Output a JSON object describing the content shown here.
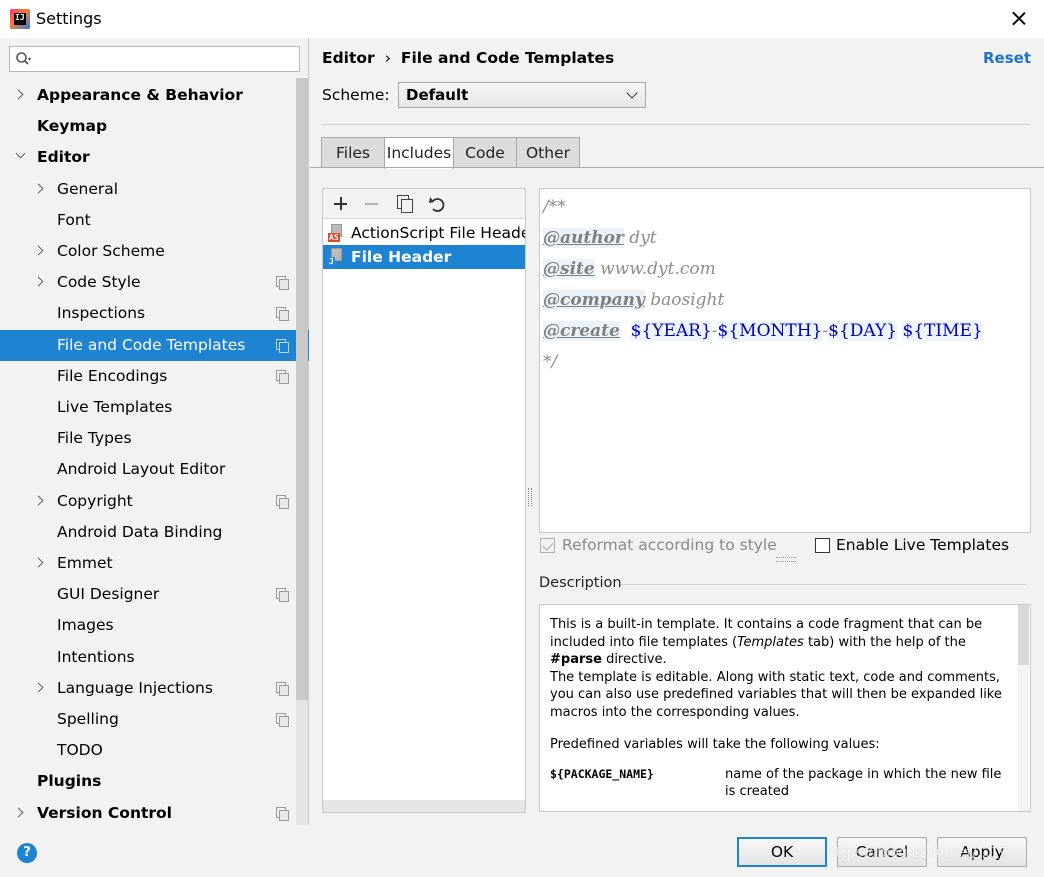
{
  "window": {
    "title": "Settings",
    "icon_text": "IJ"
  },
  "search": {
    "placeholder": ""
  },
  "tree": [
    {
      "label": "Appearance & Behavior",
      "bold": true,
      "arrow": "right",
      "level": 0,
      "copy": false
    },
    {
      "label": "Keymap",
      "bold": true,
      "arrow": "none",
      "level": 0,
      "copy": false
    },
    {
      "label": "Editor",
      "bold": true,
      "arrow": "down",
      "level": 0,
      "copy": false
    },
    {
      "label": "General",
      "bold": false,
      "arrow": "right",
      "level": 1,
      "copy": false
    },
    {
      "label": "Font",
      "bold": false,
      "arrow": "none",
      "level": 1,
      "copy": false
    },
    {
      "label": "Color Scheme",
      "bold": false,
      "arrow": "right",
      "level": 1,
      "copy": false
    },
    {
      "label": "Code Style",
      "bold": false,
      "arrow": "right",
      "level": 1,
      "copy": true
    },
    {
      "label": "Inspections",
      "bold": false,
      "arrow": "none",
      "level": 1,
      "copy": true
    },
    {
      "label": "File and Code Templates",
      "bold": false,
      "arrow": "none",
      "level": 1,
      "copy": true,
      "selected": true
    },
    {
      "label": "File Encodings",
      "bold": false,
      "arrow": "none",
      "level": 1,
      "copy": true
    },
    {
      "label": "Live Templates",
      "bold": false,
      "arrow": "none",
      "level": 1,
      "copy": false
    },
    {
      "label": "File Types",
      "bold": false,
      "arrow": "none",
      "level": 1,
      "copy": false
    },
    {
      "label": "Android Layout Editor",
      "bold": false,
      "arrow": "none",
      "level": 1,
      "copy": false
    },
    {
      "label": "Copyright",
      "bold": false,
      "arrow": "right",
      "level": 1,
      "copy": true
    },
    {
      "label": "Android Data Binding",
      "bold": false,
      "arrow": "none",
      "level": 1,
      "copy": false
    },
    {
      "label": "Emmet",
      "bold": false,
      "arrow": "right",
      "level": 1,
      "copy": false
    },
    {
      "label": "GUI Designer",
      "bold": false,
      "arrow": "none",
      "level": 1,
      "copy": true
    },
    {
      "label": "Images",
      "bold": false,
      "arrow": "none",
      "level": 1,
      "copy": false
    },
    {
      "label": "Intentions",
      "bold": false,
      "arrow": "none",
      "level": 1,
      "copy": false
    },
    {
      "label": "Language Injections",
      "bold": false,
      "arrow": "right",
      "level": 1,
      "copy": true
    },
    {
      "label": "Spelling",
      "bold": false,
      "arrow": "none",
      "level": 1,
      "copy": true
    },
    {
      "label": "TODO",
      "bold": false,
      "arrow": "none",
      "level": 1,
      "copy": false
    },
    {
      "label": "Plugins",
      "bold": true,
      "arrow": "none",
      "level": 0,
      "copy": false
    },
    {
      "label": "Version Control",
      "bold": true,
      "arrow": "right",
      "level": 0,
      "copy": true
    }
  ],
  "header": {
    "breadcrumb_root": "Editor",
    "breadcrumb_sep": "›",
    "breadcrumb_page": "File and Code Templates",
    "reset_label": "Reset"
  },
  "scheme": {
    "label": "Scheme:",
    "value": "Default"
  },
  "tabs": [
    {
      "label": "Files",
      "active": false
    },
    {
      "label": "Includes",
      "active": true
    },
    {
      "label": "Code",
      "active": false
    },
    {
      "label": "Other",
      "active": false
    }
  ],
  "templates": [
    {
      "label": "ActionScript File Header",
      "badge": "AS",
      "selected": false
    },
    {
      "label": "File Header",
      "badge": "J",
      "selected": true
    }
  ],
  "editor": {
    "line1": "/**",
    "author_tag": "@author",
    "author_val": "dyt",
    "site_tag": "@site",
    "site_val": "www.dyt.com",
    "company_tag": "@company",
    "company_val": "baosight",
    "create_tag": "@create",
    "year_var": "${YEAR}",
    "dash": "-",
    "month_var": "${MONTH}",
    "day_var": "${DAY}",
    "time_var": "${TIME}",
    "line_end": "*/"
  },
  "options": {
    "reformat_label": "Reformat according to style",
    "reformat_checked": true,
    "live_templates_label": "Enable Live Templates",
    "live_templates_checked": false
  },
  "description": {
    "label": "Description",
    "p1_a": "This is a built-in template. It contains a code fragment that can be included into file templates (",
    "p1_em": "Templates",
    "p1_b": " tab) with the help of the ",
    "p1_strong": "#parse",
    "p1_c": " directive.",
    "p2": "The template is editable. Along with static text, code and comments, you can also use predefined variables that will then be expanded like macros into the corresponding values.",
    "p3": "Predefined variables will take the following values:",
    "var_name": "${PACKAGE_NAME}",
    "var_desc": "name of the package in which the new file is created"
  },
  "buttons": {
    "help": "?",
    "ok": "OK",
    "cancel": "Cancel",
    "apply": "Apply"
  },
  "watermark": "https://blog.csdn.net/...19"
}
